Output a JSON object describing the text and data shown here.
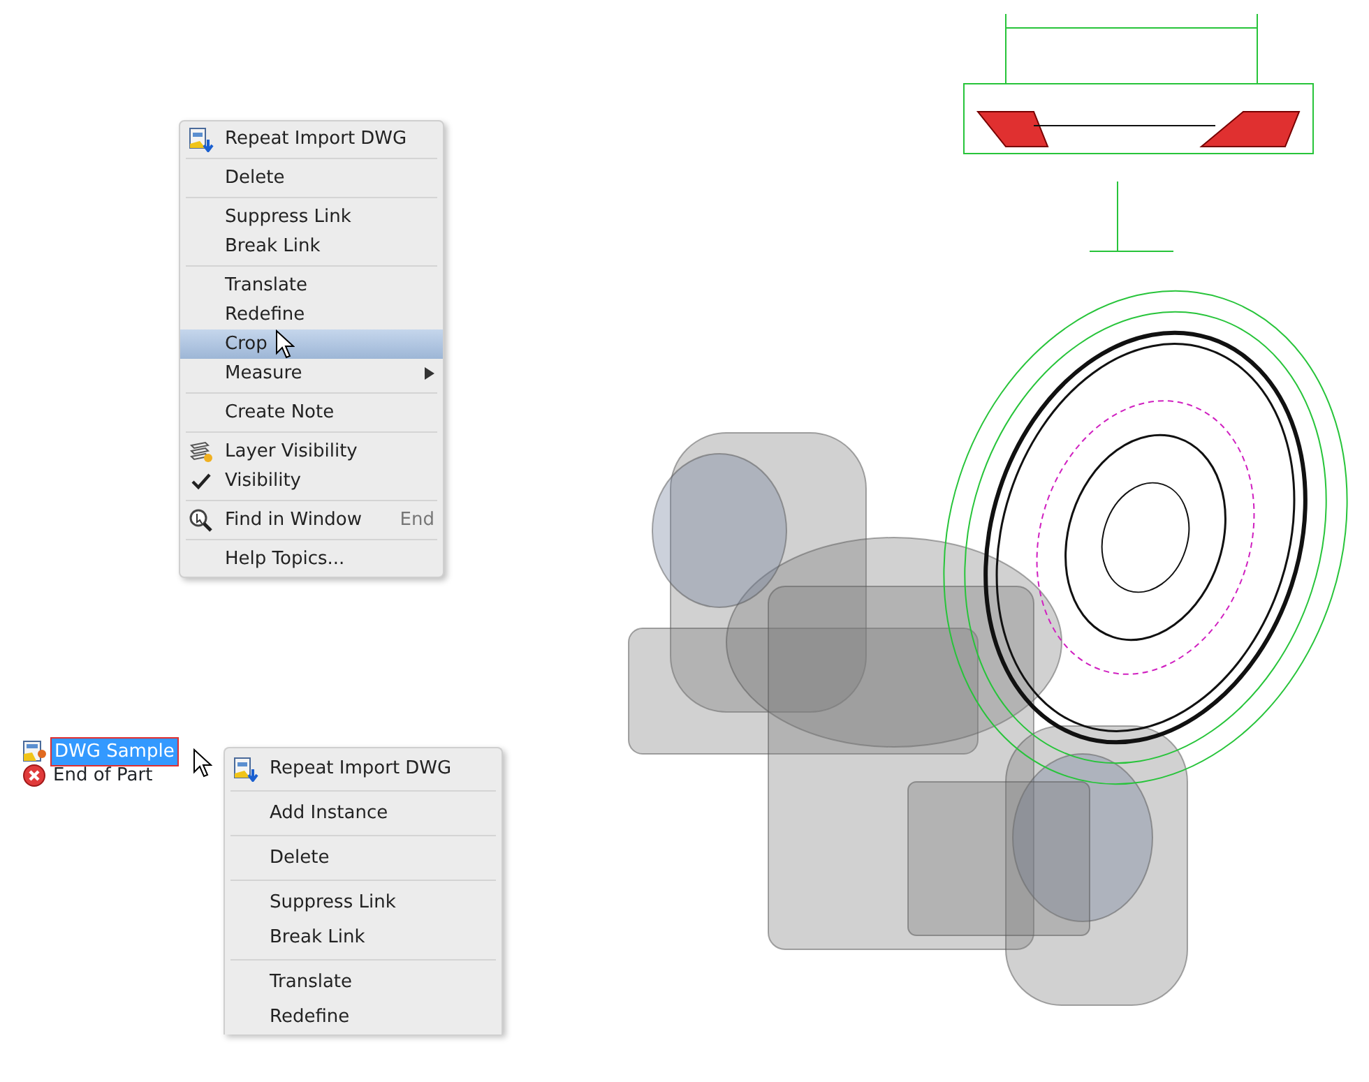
{
  "context_menu_top": {
    "groups": [
      [
        {
          "label": "Repeat Import DWG",
          "kind": "import",
          "selected": false,
          "checked": false
        }
      ],
      [
        {
          "label": "Delete",
          "selected": false,
          "checked": false
        }
      ],
      [
        {
          "label": "Suppress Link",
          "selected": false,
          "checked": false
        },
        {
          "label": "Break Link",
          "selected": false,
          "checked": false
        }
      ],
      [
        {
          "label": "Translate",
          "selected": false,
          "checked": false
        },
        {
          "label": "Redefine",
          "selected": false,
          "checked": false
        },
        {
          "label": "Crop",
          "selected": true,
          "checked": false,
          "cursor": true
        },
        {
          "label": "Measure",
          "selected": false,
          "checked": false,
          "submenu": true
        }
      ],
      [
        {
          "label": "Create Note",
          "selected": false,
          "checked": false
        }
      ],
      [
        {
          "label": "Layer Visibility",
          "kind": "layers",
          "selected": false,
          "checked": false
        },
        {
          "label": "Visibility",
          "selected": false,
          "checked": true
        }
      ],
      [
        {
          "label": "Find in Window",
          "kind": "find",
          "shortcut": "End",
          "selected": false,
          "checked": false
        }
      ],
      [
        {
          "label": "Help Topics...",
          "selected": false,
          "checked": false
        }
      ]
    ]
  },
  "browser_tree": [
    {
      "label": "DWG Sample",
      "kind": "dwg",
      "selected": true
    },
    {
      "label": "End of Part",
      "kind": "end",
      "selected": false
    }
  ],
  "context_menu_bottom": {
    "groups": [
      [
        {
          "label": "Repeat Import DWG",
          "kind": "import",
          "selected": false
        }
      ],
      [
        {
          "label": "Add Instance",
          "selected": false
        }
      ],
      [
        {
          "label": "Delete",
          "selected": false
        }
      ],
      [
        {
          "label": "Suppress Link",
          "selected": false
        },
        {
          "label": "Break Link",
          "selected": false
        }
      ],
      [
        {
          "label": "Translate",
          "selected": false
        },
        {
          "label": "Redefine",
          "selected": false
        }
      ]
    ]
  }
}
